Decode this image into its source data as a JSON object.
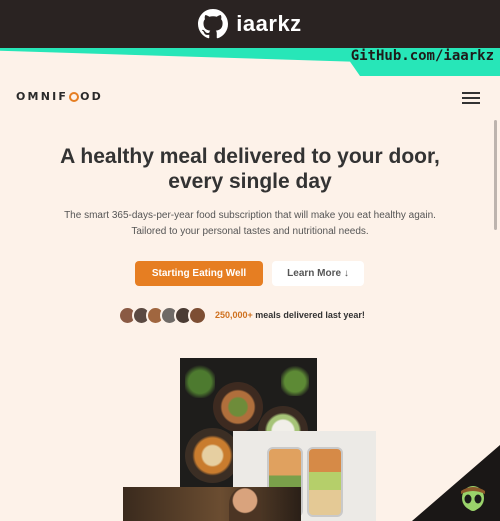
{
  "banner": {
    "username": "iaarkz",
    "github_link": "GitHub.com/iaarkz",
    "icon": "github-icon"
  },
  "header": {
    "logo_prefix": "OMNIF",
    "logo_suffix": "OD",
    "menu_icon": "hamburger-icon"
  },
  "hero": {
    "title_line1": "A healthy meal delivered to your door,",
    "title_line2": "every single day",
    "text_line1": "The smart 365-days-per-year food subscription that will make you eat healthy again.",
    "text_line2": "Tailored to your personal tastes and nutritional needs.",
    "primary_button": "Starting Eating Well",
    "secondary_button": "Learn More ↓",
    "delivered_count": "250,000+",
    "delivered_text": " meals delivered last year!"
  },
  "colors": {
    "accent": "#e67e22",
    "background": "#fdf2e9",
    "banner": "#2a2322",
    "teal": "#27e6b8"
  }
}
